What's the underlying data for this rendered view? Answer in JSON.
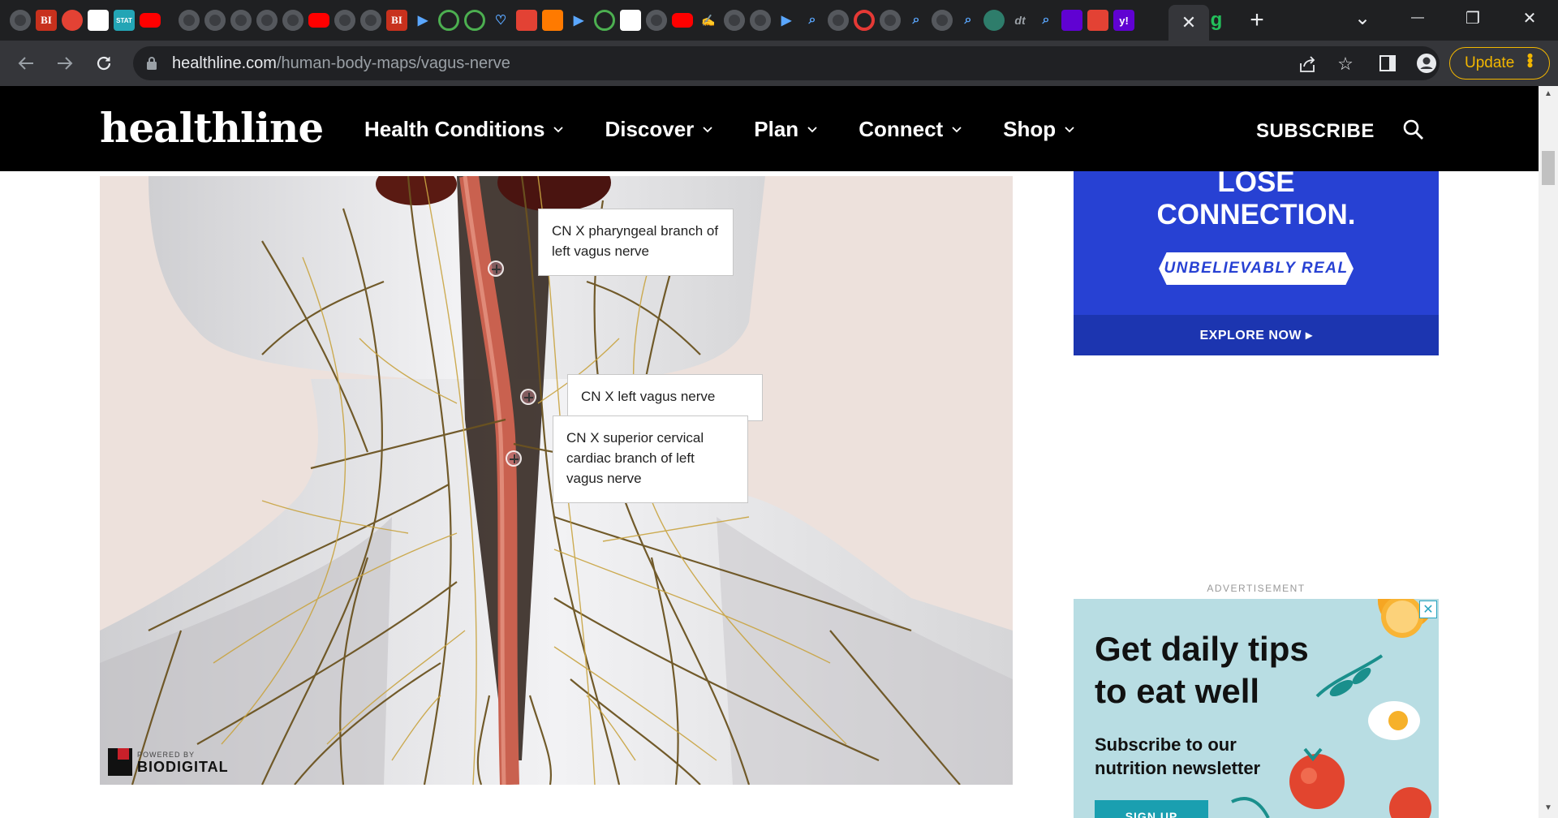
{
  "browser": {
    "tabs": {
      "favicons": [
        "globe-icon",
        "bi-icon",
        "pinwheel-icon",
        "blank-icon",
        "stat-icon",
        "youtube-icon",
        "globe-icon",
        "globe-icon",
        "globe-icon",
        "globe-icon",
        "globe-icon",
        "youtube-icon",
        "globe-icon",
        "globe-icon",
        "bi-icon",
        "forward-icon",
        "play-icon",
        "play-icon",
        "heart-icon",
        "mic-icon",
        "book-icon",
        "forward-icon",
        "play-icon",
        "map-icon",
        "globe-icon",
        "youtube-icon",
        "sign-icon",
        "globe-icon",
        "globe-icon",
        "forward-icon",
        "search-icon",
        "globe-icon",
        "refresh-icon",
        "globe-icon",
        "search-icon",
        "globe-icon",
        "search-icon",
        "tree-icon",
        "text-icon",
        "search-icon",
        "mail-icon",
        "spiral-icon",
        "yahoo-icon"
      ],
      "bi_label": "BI",
      "stat_label": "STAT",
      "active_close": "✕",
      "grammarly_label": "g",
      "new_tab": "+"
    },
    "window": {
      "dropdown": "⌄",
      "minimize": "—",
      "restore": "❐",
      "close": "✕"
    },
    "url": {
      "domain": "healthline.com",
      "path": "/human-body-maps/vagus-nerve"
    },
    "update_label": "Update"
  },
  "site": {
    "logo": "healthline",
    "nav": [
      {
        "label": "Health Conditions"
      },
      {
        "label": "Discover"
      },
      {
        "label": "Plan"
      },
      {
        "label": "Connect"
      },
      {
        "label": "Shop"
      }
    ],
    "subscribe": "SUBSCRIBE"
  },
  "viewer": {
    "callouts": [
      {
        "text": "CN X pharyngeal branch of left vagus nerve"
      },
      {
        "text": "CN X left vagus nerve"
      },
      {
        "text": "CN X superior cervical cardiac branch of left vagus nerve"
      }
    ],
    "brand": {
      "powered": "POWERED BY",
      "name": "BIODIGITAL"
    }
  },
  "ads": {
    "ad1": {
      "headline_1": "LOSE",
      "headline_2": "CONNECTION.",
      "tagline": "UNBELIEVABLY REAL",
      "cta": "EXPLORE NOW ▸"
    },
    "label": "ADVERTISEMENT",
    "ad2": {
      "headline_1": "Get daily tips",
      "headline_2": "to eat well",
      "sub_1": "Subscribe to our",
      "sub_2": "nutrition newsletter",
      "cta": "SIGN UP",
      "close": "✕"
    }
  },
  "colors": {
    "tabstrip": "#1f2022",
    "toolbar": "#35363a",
    "header": "#000000",
    "update": "#f2b600",
    "viewer_bg": "#ede1dc",
    "vagus": "#c9614f",
    "ad1_bg": "#2741d3",
    "ad2_bg": "#b8dde3"
  }
}
